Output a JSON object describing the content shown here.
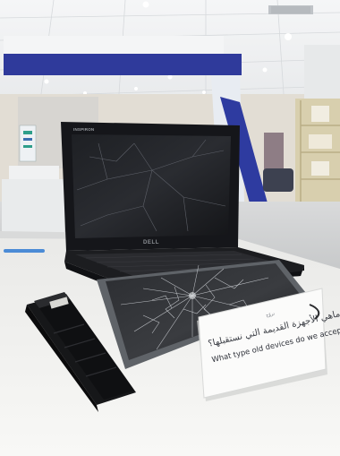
{
  "scene": {
    "laptop_brand": "INSPIRON",
    "laptop_logo": "DELL",
    "sign": {
      "top_label": "تروّح",
      "arabic": "ماهي الأجهزة القديمة التي نستقبلها؟",
      "english": "What type old devices do we accept ?"
    },
    "colors": {
      "ceiling": "#eef0f2",
      "banner_blue": "#2f3a9b",
      "pillar_blue": "#2e3ba0",
      "wall": "#e2ddd4",
      "floor": "#cfd1d1",
      "display_table": "#f3f3f1",
      "laptop_body": "#1c1d20",
      "tablet_frame": "#5f6368",
      "battery": "#161719",
      "sign_card": "#fbfbfa"
    }
  }
}
